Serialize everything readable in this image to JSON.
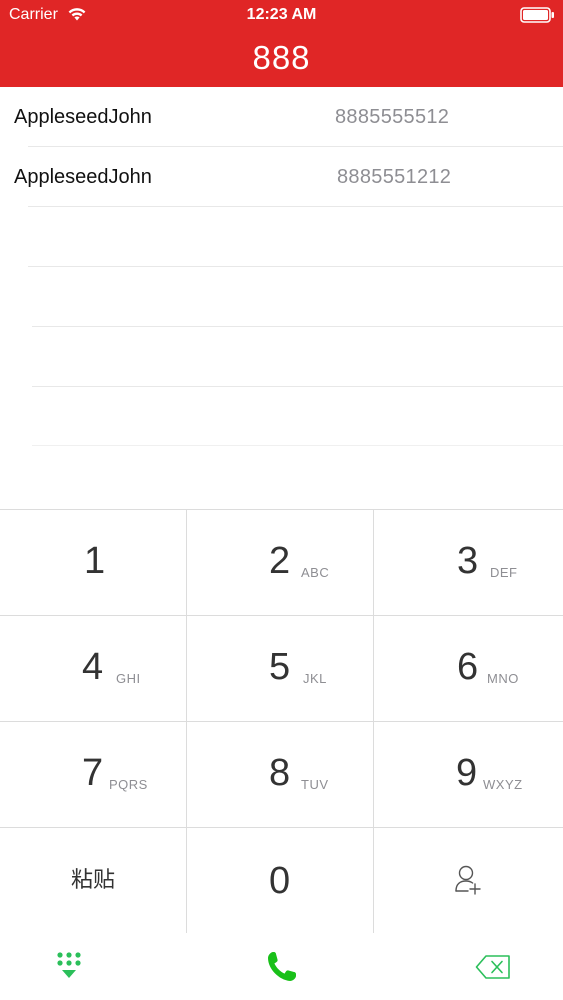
{
  "status_bar": {
    "carrier": "Carrier",
    "time": "12:23 AM"
  },
  "dial_display": "888",
  "results": [
    {
      "name": "AppleseedJohn",
      "number": "8885555512"
    },
    {
      "name": "AppleseedJohn",
      "number": "8885551212"
    }
  ],
  "keypad": {
    "keys": [
      {
        "digit": "1",
        "letters": ""
      },
      {
        "digit": "2",
        "letters": "ABC"
      },
      {
        "digit": "3",
        "letters": "DEF"
      },
      {
        "digit": "4",
        "letters": "GHI"
      },
      {
        "digit": "5",
        "letters": "JKL"
      },
      {
        "digit": "6",
        "letters": "MNO"
      },
      {
        "digit": "7",
        "letters": "PQRS"
      },
      {
        "digit": "8",
        "letters": "TUV"
      },
      {
        "digit": "9",
        "letters": "WXYZ"
      }
    ],
    "paste_label": "粘贴",
    "zero": "0"
  },
  "bottom_bar": {
    "keypad_icon": "dialpad-icon",
    "call_icon": "phone-icon",
    "delete_icon": "backspace-icon"
  },
  "colors": {
    "header": "#e02626",
    "accent_green": "#2bbf5a",
    "call_green": "#19c019"
  }
}
